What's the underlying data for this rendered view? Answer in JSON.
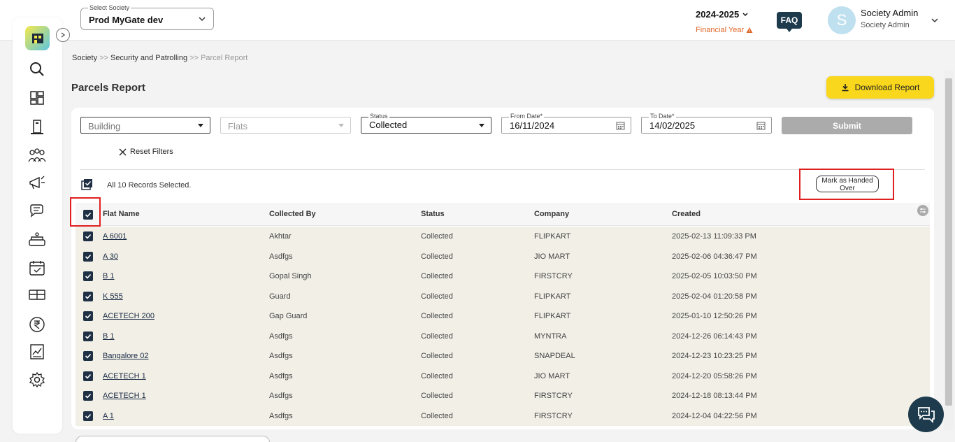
{
  "header": {
    "society_label": "Select Society",
    "society_value": "Prod MyGate dev",
    "fy_year": "2024-2025",
    "fy_label": "Financial Year",
    "faq": "FAQ",
    "avatar_letter": "S",
    "user_name": "Society Admin",
    "user_role": "Society Admin"
  },
  "sidebar": {
    "icons": [
      "search-icon",
      "dashboard-icon",
      "building-icon",
      "people-icon",
      "megaphone-icon",
      "chat-icon",
      "facility-icon",
      "calendar-icon",
      "parking-icon",
      "rupee-icon",
      "report-icon",
      "gear-icon"
    ]
  },
  "breadcrumb": {
    "c1": "Society",
    "sep1": " >> ",
    "c2": "Security and Patrolling",
    "sep2": " >> ",
    "c3": "Parcel Report"
  },
  "page": {
    "title": "Parcels Report",
    "download": "Download Report"
  },
  "filters": {
    "building": "Building",
    "flats": "Flats",
    "status_label": "Status",
    "status_value": "Collected",
    "from_label": "From Date*",
    "from_value": "16/11/2024",
    "to_label": "To Date*",
    "to_value": "14/02/2025",
    "submit": "Submit",
    "reset": "Reset Filters"
  },
  "selection": {
    "text": "All 10 Records Selected.",
    "mark_button": "Mark as Handed Over"
  },
  "table": {
    "headers": [
      "Flat Name",
      "Collected By",
      "Status",
      "Company",
      "Created"
    ],
    "rows": [
      [
        "A 6001",
        "Akhtar",
        "Collected",
        "FLIPKART",
        "2025-02-13 11:09:33 PM"
      ],
      [
        "A 30",
        "Asdfgs",
        "Collected",
        "JIO MART",
        "2025-02-06 04:36:47 PM"
      ],
      [
        "B 1",
        "Gopal Singh",
        "Collected",
        "FIRSTCRY",
        "2025-02-05 10:03:50 PM"
      ],
      [
        "K 555",
        "Guard",
        "Collected",
        "FLIPKART",
        "2025-02-04 01:20:58 PM"
      ],
      [
        "ACETECH 200",
        "Gap Guard",
        "Collected",
        "FLIPKART",
        "2025-01-10 12:50:26 PM"
      ],
      [
        "B 1",
        "Asdfgs",
        "Collected",
        "MYNTRA",
        "2024-12-26 06:14:43 PM"
      ],
      [
        "Bangalore 02",
        "Asdfgs",
        "Collected",
        "SNAPDEAL",
        "2024-12-23 10:23:25 PM"
      ],
      [
        "ACETECH 1",
        "Asdfgs",
        "Collected",
        "JIO MART",
        "2024-12-20 05:58:26 PM"
      ],
      [
        "ACETECH 1",
        "Asdfgs",
        "Collected",
        "FIRSTCRY",
        "2024-12-18 08:13:44 PM"
      ],
      [
        "A 1",
        "Asdfgs",
        "Collected",
        "FIRSTCRY",
        "2024-12-04 04:22:56 PM"
      ]
    ]
  },
  "colors": {
    "accent": "#f9d71c",
    "dark": "#1d3b4c",
    "highlight": "#e02020",
    "row_bg": "#f1efe6"
  }
}
